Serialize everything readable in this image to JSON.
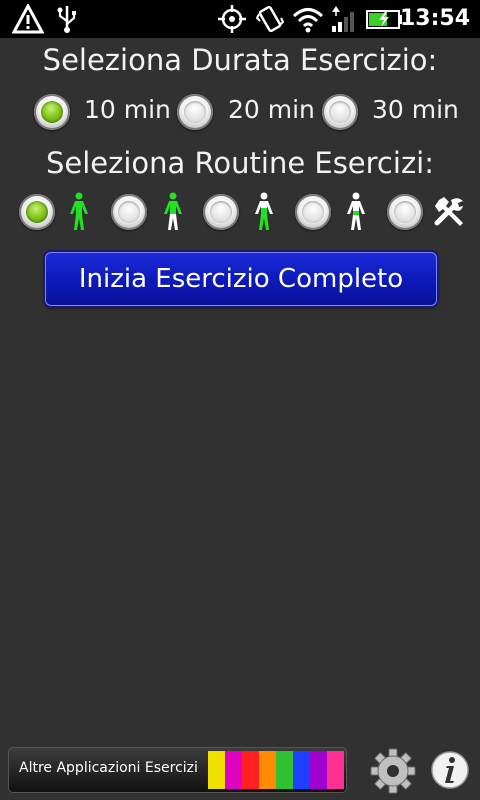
{
  "status_bar": {
    "time": "13:54",
    "icons": [
      "alert-triangle-icon",
      "usb-icon",
      "gps-icon",
      "vibrate-icon",
      "wifi-icon",
      "signal-icon",
      "battery-charging-icon"
    ]
  },
  "duration": {
    "title": "Seleziona Durata Esercizio:",
    "options": [
      {
        "label": "10 min",
        "checked": true
      },
      {
        "label": "20 min",
        "checked": false
      },
      {
        "label": "30 min",
        "checked": false
      }
    ]
  },
  "routine": {
    "title": "Seleziona Routine Esercizi:",
    "options": [
      {
        "icon": "full-body-figure-icon",
        "checked": true
      },
      {
        "icon": "upper-body-figure-icon",
        "checked": false
      },
      {
        "icon": "mid-body-figure-icon",
        "checked": false
      },
      {
        "icon": "lower-body-figure-icon",
        "checked": false
      },
      {
        "icon": "custom-tools-icon",
        "checked": false
      }
    ],
    "colors": {
      "highlight": "#22e022",
      "figure": "#ffffff"
    }
  },
  "start_button": {
    "label": "Inizia Esercizio Completo"
  },
  "footer": {
    "banner_label": "Altre Applicazioni Esercizi",
    "banner_icon": "exercise-apps-strip-icon",
    "settings_icon": "gear-icon",
    "info_icon": "info-icon"
  },
  "colors": {
    "background": "#313131",
    "button": "#0d19b8",
    "radio_checked": "#86c81e"
  }
}
